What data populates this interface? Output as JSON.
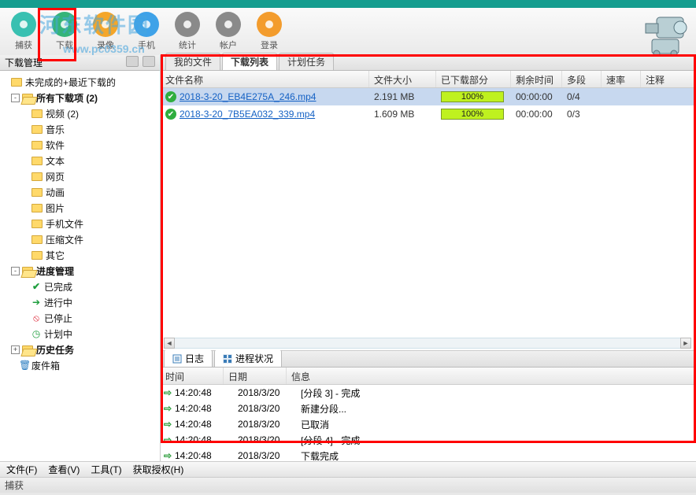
{
  "watermark": {
    "line1": "河东软件园",
    "line2": "www.pc0359.cn"
  },
  "toolbar": {
    "items": [
      {
        "label": "捕获",
        "color": "#39c0b1"
      },
      {
        "label": "下载",
        "color": "#35b479"
      },
      {
        "label": "录像",
        "color": "#f4a62a"
      },
      {
        "label": "手机",
        "color": "#3fa2e8"
      },
      {
        "label": "统计",
        "color": "#8a8a8a"
      },
      {
        "label": "帐户",
        "color": "#8a8a8a"
      },
      {
        "label": "登录",
        "color": "#f39c2d"
      }
    ]
  },
  "sidebar": {
    "title": "下载管理",
    "items": [
      {
        "label": "未完成的+最近下载的",
        "icon": "folder",
        "indent": 14
      },
      {
        "label": "所有下载项 (2)",
        "icon": "folder-open",
        "indent": 14,
        "bold": true,
        "toggle": "-"
      },
      {
        "label": "视频 (2)",
        "icon": "folder",
        "indent": 40
      },
      {
        "label": "音乐",
        "icon": "folder",
        "indent": 40
      },
      {
        "label": "软件",
        "icon": "folder",
        "indent": 40
      },
      {
        "label": "文本",
        "icon": "folder",
        "indent": 40
      },
      {
        "label": "网页",
        "icon": "folder",
        "indent": 40
      },
      {
        "label": "动画",
        "icon": "folder",
        "indent": 40
      },
      {
        "label": "图片",
        "icon": "folder",
        "indent": 40
      },
      {
        "label": "手机文件",
        "icon": "folder",
        "indent": 40
      },
      {
        "label": "压缩文件",
        "icon": "folder",
        "indent": 40
      },
      {
        "label": "其它",
        "icon": "folder",
        "indent": 40
      },
      {
        "label": "进度管理",
        "icon": "folder-open",
        "indent": 14,
        "bold": true,
        "toggle": "-"
      },
      {
        "label": "已完成",
        "icon": "check",
        "indent": 40
      },
      {
        "label": "进行中",
        "icon": "arrow",
        "indent": 40
      },
      {
        "label": "已停止",
        "icon": "stop",
        "indent": 40
      },
      {
        "label": "计划中",
        "icon": "clock",
        "indent": 40
      },
      {
        "label": "历史任务",
        "icon": "folder-open",
        "indent": 14,
        "bold": true,
        "toggle": "+"
      },
      {
        "label": "废件箱",
        "icon": "trash",
        "indent": 24
      }
    ]
  },
  "tabs": {
    "items": [
      "我的文件",
      "下载列表",
      "计划任务"
    ],
    "active": 1
  },
  "columns": {
    "name": "文件名称",
    "size": "文件大小",
    "prog": "已下载部分",
    "rem": "剩余时间",
    "seg": "多段",
    "rate": "速率",
    "note": "注释"
  },
  "rows": [
    {
      "name": "2018-3-20_7B5EA032_339.mp4",
      "size": "1.609 MB",
      "prog": "100%",
      "rem": "00:00:00",
      "seg": "0/3"
    },
    {
      "name": "2018-3-20_EB4E275A_246.mp4",
      "size": "2.191 MB",
      "prog": "100%",
      "rem": "00:00:00",
      "seg": "0/4"
    }
  ],
  "subtabs": {
    "items": [
      "日志",
      "进程状况"
    ],
    "active": 0
  },
  "logcols": {
    "time": "时间",
    "date": "日期",
    "info": "信息"
  },
  "logs": [
    {
      "t": "14:20:48",
      "d": "2018/3/20",
      "m": "[分段 3] - 完成"
    },
    {
      "t": "14:20:48",
      "d": "2018/3/20",
      "m": "新建分段..."
    },
    {
      "t": "14:20:48",
      "d": "2018/3/20",
      "m": "已取消"
    },
    {
      "t": "14:20:48",
      "d": "2018/3/20",
      "m": "[分段 4] - 完成"
    },
    {
      "t": "14:20:48",
      "d": "2018/3/20",
      "m": "下载完成"
    }
  ],
  "menu": {
    "file": "文件(F)",
    "view": "查看(V)",
    "tool": "工具(T)",
    "auth": "获取授权(H)"
  },
  "status": "捕获"
}
